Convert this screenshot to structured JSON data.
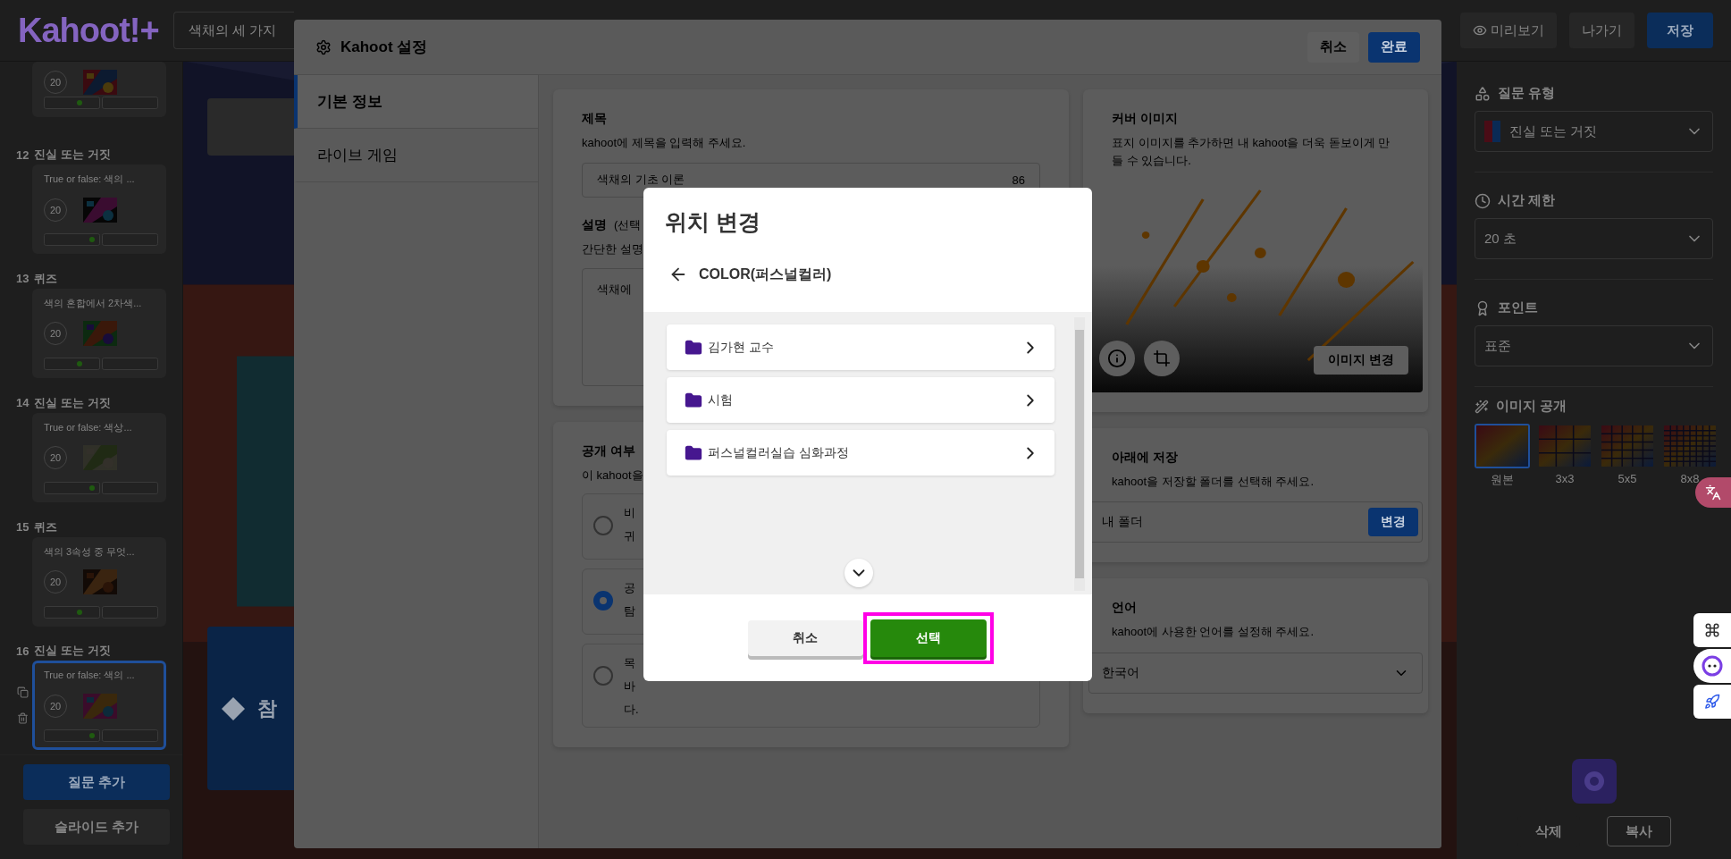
{
  "header": {
    "logo": "Kahoot!+",
    "title": "색채의 세 가지",
    "preview": "미리보기",
    "exit": "나가기",
    "save": "저장"
  },
  "slides": [
    {
      "time": "20",
      "selected": false
    },
    {
      "number": "12",
      "type": "진실 또는 거짓",
      "question": "True or false: 색의 ...",
      "time": "20",
      "selected": false
    },
    {
      "number": "13",
      "type": "퀴즈",
      "question": "색의 혼합에서 2차색...",
      "time": "20",
      "selected": false
    },
    {
      "number": "14",
      "type": "진실 또는 거짓",
      "question": "True or false: 색상...",
      "time": "20",
      "selected": false
    },
    {
      "number": "15",
      "type": "퀴즈",
      "question": "색의 3속성 중 무엇...",
      "time": "20",
      "selected": false
    },
    {
      "number": "16",
      "type": "진실 또는 거짓",
      "question": "True or false: 색의 ...",
      "time": "20",
      "selected": true
    }
  ],
  "sidebar_buttons": [
    "질문 추가",
    "슬라이드 추가"
  ],
  "canvas": {
    "answer": "참"
  },
  "right_panel": {
    "fields": [
      {
        "label": "질문 유형",
        "value": "진실 또는 거짓",
        "kind": "type"
      },
      {
        "label": "시간 제한",
        "value": "20 초",
        "kind": "time"
      },
      {
        "label": "포인트",
        "value": "표준",
        "kind": "points"
      }
    ],
    "reveal_label": "이미지 공개",
    "reveal_options": [
      {
        "label": "원본",
        "selected": true
      },
      {
        "label": "3x3",
        "selected": false
      },
      {
        "label": "5x5",
        "selected": false
      },
      {
        "label": "8x8",
        "selected": false
      }
    ],
    "delete": "삭제",
    "copy": "복사"
  },
  "settings": {
    "title": "Kahoot 설정",
    "cancel": "취소",
    "done": "완료",
    "nav": [
      {
        "label": "기본 정보",
        "selected": true
      },
      {
        "label": "라이브 게임",
        "selected": false
      }
    ],
    "name": {
      "heading": "제목",
      "hint": "kahoot에 제목을 입력해 주세요.",
      "value": "색채의 기초 이론",
      "count": "86"
    },
    "description": {
      "heading": "설명",
      "note": "(선택",
      "hint": "간단한 설명",
      "value": "색채에"
    },
    "visibility": {
      "heading": "공개 여부",
      "hint": "이 kahoot을",
      "options": [
        {
          "lines": [
            "비",
            "귀"
          ],
          "selected": false
        },
        {
          "lines": [
            "공",
            "탐"
          ],
          "selected": true
        },
        {
          "lines": [
            "목",
            "바",
            "다."
          ],
          "selected": false
        }
      ]
    },
    "cover": {
      "heading": "커버 이미지",
      "hint": "표지 이미지를 추가하면 내 kahoot을 더욱 돋보이게 만들 수 있습니다.",
      "change": "이미지 변경"
    },
    "save_location": {
      "heading": "아래에 저장",
      "hint": "kahoot을 저장할 폴더를 선택해 주세요.",
      "value": "내 폴더",
      "button": "변경"
    },
    "language": {
      "heading": "언어",
      "hint": "kahoot에 사용한 언어를 설정해 주세요.",
      "value": "한국어"
    }
  },
  "dialog": {
    "title": "위치 변경",
    "path": "COLOR(퍼스널컬러)",
    "folders": [
      "김가현 교수",
      "시험",
      "퍼스널컬러실습 심화과정"
    ],
    "cancel": "취소",
    "select": {
      "label": "선택",
      "highlighted": true
    }
  }
}
